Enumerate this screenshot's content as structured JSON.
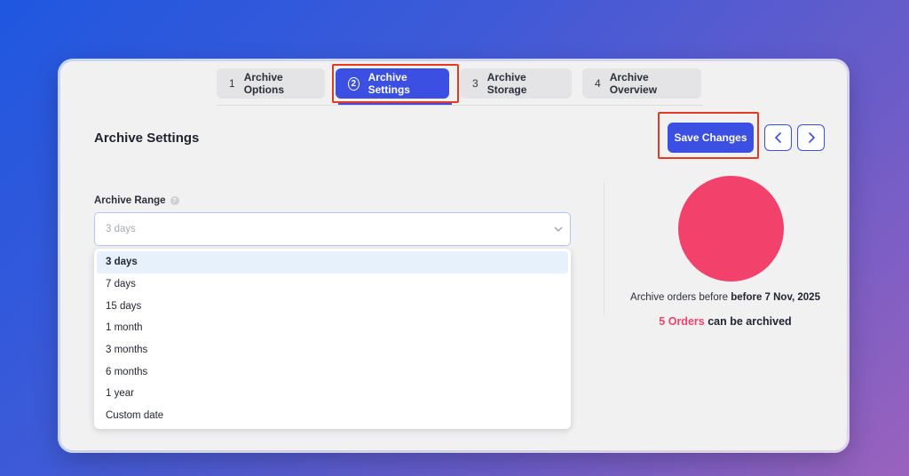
{
  "steps": [
    {
      "num": "1",
      "label": "Archive Options"
    },
    {
      "num": "2",
      "label": "Archive Settings"
    },
    {
      "num": "3",
      "label": "Archive Storage"
    },
    {
      "num": "4",
      "label": "Archive Overview"
    }
  ],
  "header": {
    "title": "Archive Settings",
    "save_label": "Save Changes"
  },
  "archive_range": {
    "label": "Archive Range",
    "value": "3 days",
    "options": [
      "3 days",
      "7 days",
      "15 days",
      "1 month",
      "3 months",
      "6 months",
      "1 year",
      "Custom date"
    ]
  },
  "summary": {
    "text_prefix": "Archive orders before",
    "date_text": "before 7 Nov, 2025",
    "count_text": "5 Orders",
    "count_suffix": "can be archived"
  },
  "colors": {
    "accent": "#3b4fe2",
    "pie": "#f2426c",
    "highlight_box": "#e53a1f"
  }
}
